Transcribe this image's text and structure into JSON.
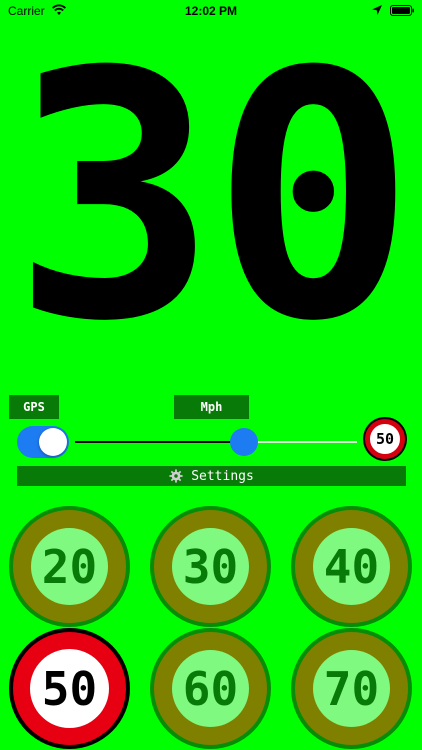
{
  "status_bar": {
    "carrier": "Carrier",
    "time": "12:02 PM"
  },
  "speed": {
    "current": "30"
  },
  "controls": {
    "gps_label": "GPS",
    "units_label": "Mph",
    "gps_enabled": true,
    "slider_value": 0.6,
    "limit_sign": "50",
    "settings_label": "Settings"
  },
  "speed_buttons": [
    {
      "label": "20",
      "selected": false
    },
    {
      "label": "30",
      "selected": false
    },
    {
      "label": "40",
      "selected": false
    },
    {
      "label": "50",
      "selected": true
    },
    {
      "label": "60",
      "selected": false
    },
    {
      "label": "70",
      "selected": false
    }
  ],
  "colors": {
    "background": "#00ff00",
    "accent": "#1e7cf2",
    "label_bg": "#087a08",
    "sign_red": "#d4000f",
    "button_ring": "#808000",
    "button_inner": "#7ff97f"
  }
}
